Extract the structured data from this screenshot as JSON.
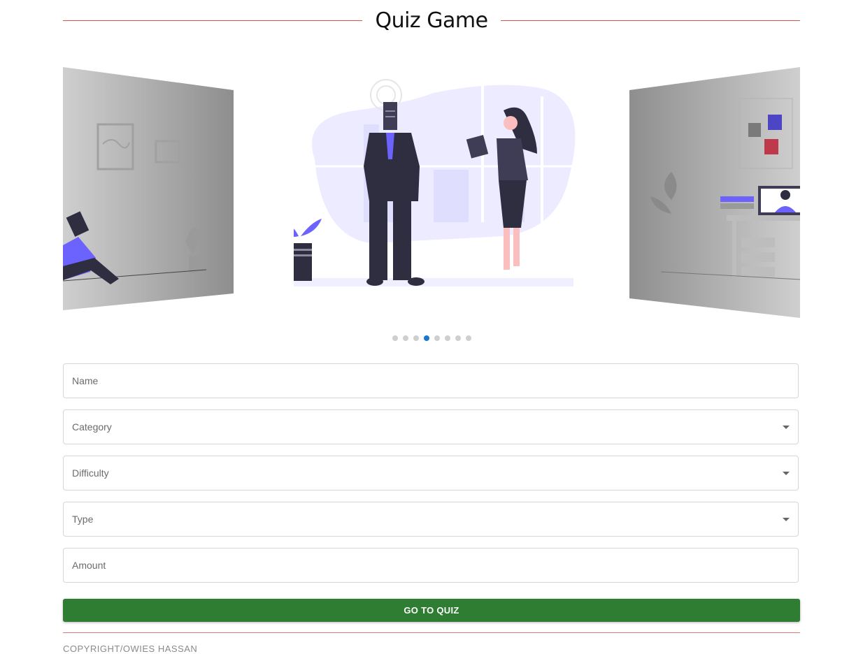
{
  "header": {
    "title": "Quiz Game"
  },
  "carousel": {
    "slide_count": 8,
    "active_index": 3
  },
  "form": {
    "name_placeholder": "Name",
    "category_placeholder": "Category",
    "difficulty_placeholder": "Difficulty",
    "type_placeholder": "Type",
    "amount_placeholder": "Amount",
    "submit_label": "GO TO QUIZ"
  },
  "footer": {
    "copyright": "COPYRIGHT/OWIES HASSAN"
  },
  "colors": {
    "accent_line": "#d9534f",
    "button_bg": "#2e7d32",
    "active_dot": "#1976d2",
    "illustration_purple": "#6c63ff"
  },
  "icons": [
    "chevron-down-icon"
  ]
}
